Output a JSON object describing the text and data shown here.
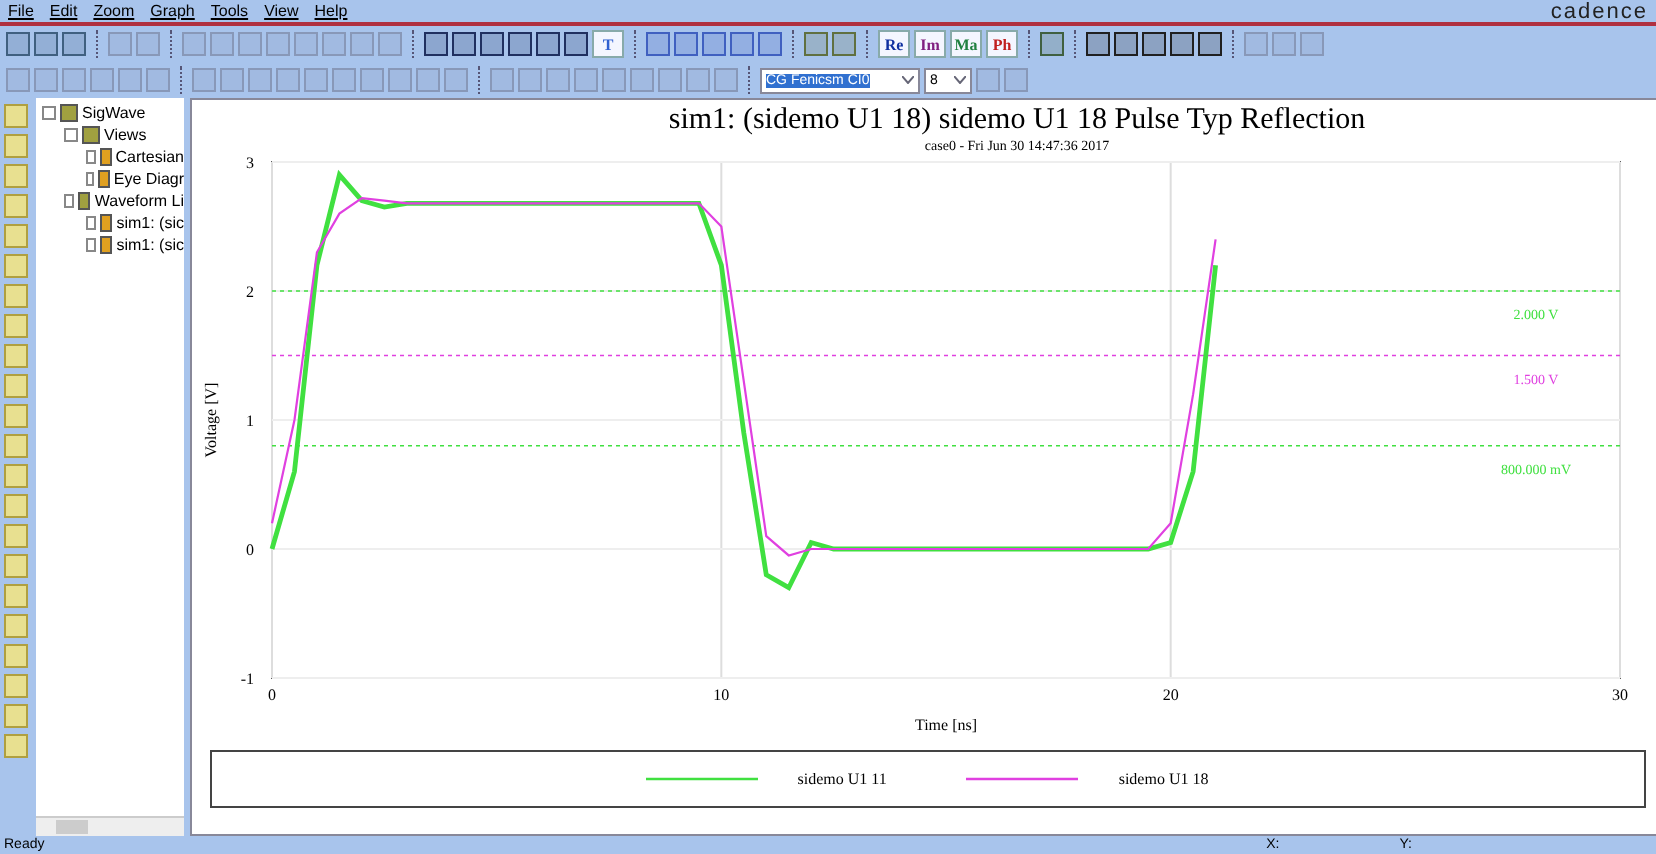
{
  "menu": [
    "File",
    "Edit",
    "Zoom",
    "Graph",
    "Tools",
    "View",
    "Help"
  ],
  "brand": "cadence",
  "toolbar": {
    "text_buttons": [
      {
        "label": "T",
        "color": "#3060d0"
      }
    ],
    "part_buttons": [
      {
        "label": "Re",
        "color": "#1030a0"
      },
      {
        "label": "Im",
        "color": "#802080"
      },
      {
        "label": "Ma",
        "color": "#208040"
      },
      {
        "label": "Ph",
        "color": "#c02020"
      }
    ],
    "font_name": "CG Fenicsm CI0",
    "font_size": "8"
  },
  "tree": [
    {
      "label": "SigWave",
      "children": [
        {
          "label": "Views",
          "children": [
            {
              "label": "Cartesian"
            },
            {
              "label": "Eye Diagr"
            }
          ]
        },
        {
          "label": "Waveform Li",
          "children": [
            {
              "label": "sim1: (sic"
            },
            {
              "label": "sim1: (sic"
            }
          ]
        }
      ]
    }
  ],
  "graph": {
    "title": "sim1: (sidemo U1 18) sidemo U1 18 Pulse Typ Reflection",
    "subtitle": "case0 - Fri Jun 30 14:47:36 2017",
    "chart_data": {
      "type": "line",
      "xlabel": "Time [ns]",
      "ylabel": "Voltage [V]",
      "xlim": [
        0,
        30
      ],
      "ylim": [
        -1,
        3
      ],
      "xticks": [
        0,
        10,
        20,
        30
      ],
      "yticks": [
        -1,
        0,
        1,
        2,
        3
      ],
      "x": [
        0,
        0.5,
        1,
        1.5,
        2,
        2.5,
        3,
        5,
        9.5,
        10,
        10.5,
        11,
        11.5,
        12,
        12.5,
        13,
        15,
        19.5,
        20,
        20.5,
        21
      ],
      "series": [
        {
          "name": "sidemo U1 11",
          "color": "#40e040",
          "values": [
            0,
            0.6,
            2.2,
            2.9,
            2.7,
            2.65,
            2.68,
            2.68,
            2.68,
            2.2,
            0.9,
            -0.2,
            -0.3,
            0.05,
            0,
            0,
            0,
            0,
            0.05,
            0.6,
            2.2
          ]
        },
        {
          "name": "sidemo U1 18",
          "color": "#e040e0",
          "values": [
            0.2,
            1.0,
            2.3,
            2.6,
            2.72,
            2.7,
            2.68,
            2.68,
            2.68,
            2.5,
            1.3,
            0.1,
            -0.05,
            0,
            0,
            0,
            0,
            0,
            0.2,
            1.2,
            2.4
          ]
        }
      ],
      "grid": true,
      "ref_lines": [
        {
          "axis": "y",
          "value": 2,
          "label": "2.000 V",
          "color": "#40e040"
        },
        {
          "axis": "y",
          "value": 1.5,
          "label": "1.500 V",
          "color": "#e040e0"
        },
        {
          "axis": "y",
          "value": 0.8,
          "label": "800.000 mV",
          "color": "#40e040"
        }
      ]
    }
  },
  "status_bar": {
    "message": "Ready",
    "x_label": "X:",
    "y_label": "Y:"
  }
}
